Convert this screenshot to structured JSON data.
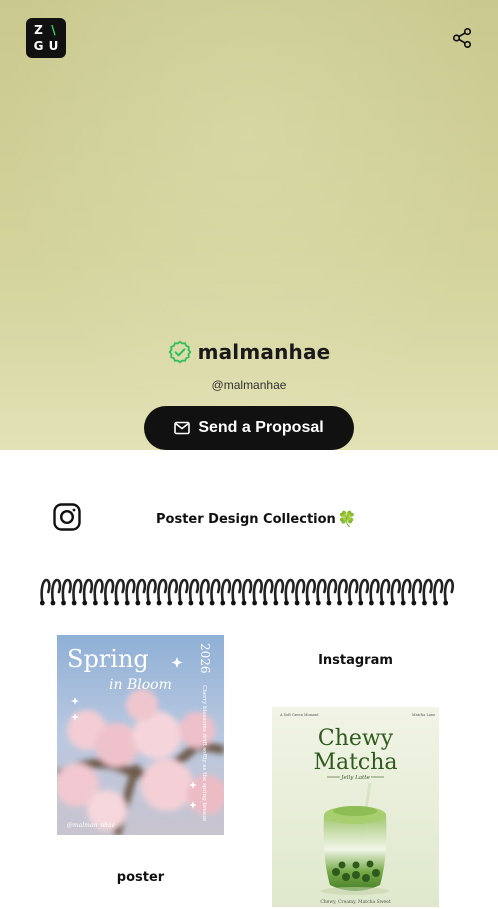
{
  "brand": {
    "logo_letters": [
      "Z",
      "\\",
      "G",
      "U"
    ]
  },
  "header": {
    "share_icon": "share-icon"
  },
  "profile": {
    "name": "malmanhae",
    "handle": "@malmanhae",
    "verified_icon": "verified-badge-icon",
    "verified_color": "#2fbf5a",
    "proposal_label": "Send a Proposal"
  },
  "links": {
    "instagram_icon": "instagram-icon",
    "collection_title": "Poster Design Collection",
    "collection_emoji": "🍀"
  },
  "grid": {
    "items": [
      {
        "caption": "poster",
        "poster": {
          "title_line1": "Spring",
          "title_line2": "in Bloom",
          "year": "2026",
          "side_text": "Cherry blossoms drift softly as the spring breeze",
          "handle": "@malman_nhae"
        }
      },
      {
        "caption": "Instagram",
        "poster": {
          "top_left": "A Soft Green Moment",
          "top_right": "Matcha Lane",
          "title_line1": "Chewy",
          "title_line2": "Matcha",
          "subtitle": "Jelly Latte",
          "footer": "Chewy, Creamy, Matcha Sweet"
        }
      }
    ]
  },
  "colors": {
    "hero_bg": "#d2d29a",
    "button_bg": "#111111",
    "matcha_green": "#4f8a2c"
  }
}
